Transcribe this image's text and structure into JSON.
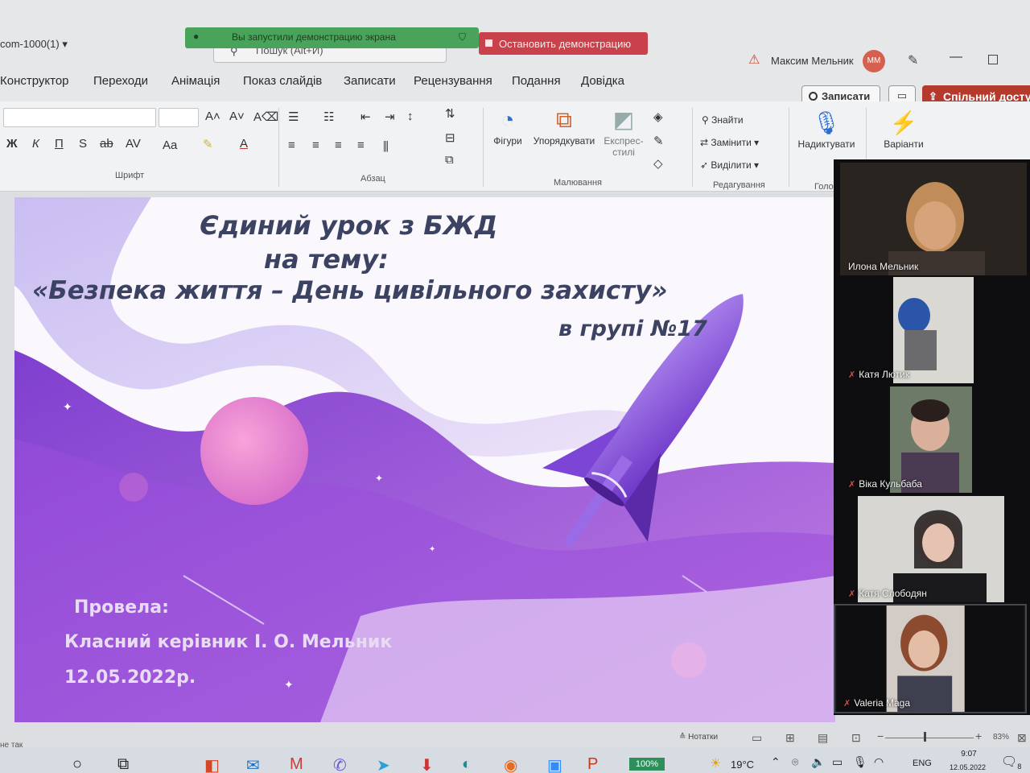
{
  "window": {
    "filename": "com-1000(1)",
    "search_placeholder": "Пошук (Alt+И)",
    "share_banner": "Вы запустили демонстрацию экрана",
    "stop_demo": "Остановить демонстрацию",
    "user_name": "Максим Мельник",
    "avatar_initials": "ММ"
  },
  "tabs": [
    "Конструктор",
    "Переходи",
    "Анімація",
    "Показ слайдів",
    "Записати",
    "Рецензування",
    "Подання",
    "Довідка"
  ],
  "ribbon_actions": {
    "record": "Записати",
    "share": "Спільний досту"
  },
  "ribbon": {
    "font_group": "Шрифт",
    "paragraph_group": "Абзац",
    "drawing_group": "Малювання",
    "editing_group": "Редагування",
    "voice_group": "Голо",
    "font_buttons": [
      "Ж",
      "К",
      "П",
      "S",
      "ab",
      "AV",
      "Aa"
    ],
    "shapes": "Фігури",
    "arrange": "Упорядкувати",
    "express_1": "Експрес-",
    "express_2": "стилі",
    "find": "Знайти",
    "replace": "Замінити",
    "select": "Виділити",
    "dictate": "Надиктувати",
    "variants": "Варіанти"
  },
  "slide": {
    "line1": "Єдиний урок з БЖД",
    "line2": "на тему:",
    "line3": "«Безпека життя – День цивільного захисту»",
    "line4": "в групі №17",
    "foot1": "Провела:",
    "foot2": "Класний керівник І. О. Мельник",
    "foot3": "12.05.2022р."
  },
  "participants": [
    {
      "name": "Илона Мельник",
      "muted": false
    },
    {
      "name": "Катя Лютик",
      "muted": true
    },
    {
      "name": "Віка Кульбаба",
      "muted": true
    },
    {
      "name": "Катя Слободян",
      "muted": true
    },
    {
      "name": "Valeria Maga",
      "muted": true
    }
  ],
  "statusbar": {
    "left": "не так",
    "notes": "Нотатки",
    "zoom": "83%"
  },
  "taskbar": {
    "zoom_badge": "100%",
    "weather": "19°C",
    "lang": "ENG",
    "time": "9:07",
    "date": "12.05.2022",
    "notif_count": "8"
  },
  "colors": {
    "accent_red": "#b33a2c",
    "banner_green": "#4aa35a",
    "stop_red": "#c9414a",
    "slide_purple": "#8a3fd0",
    "title_text": "#3c4262"
  }
}
